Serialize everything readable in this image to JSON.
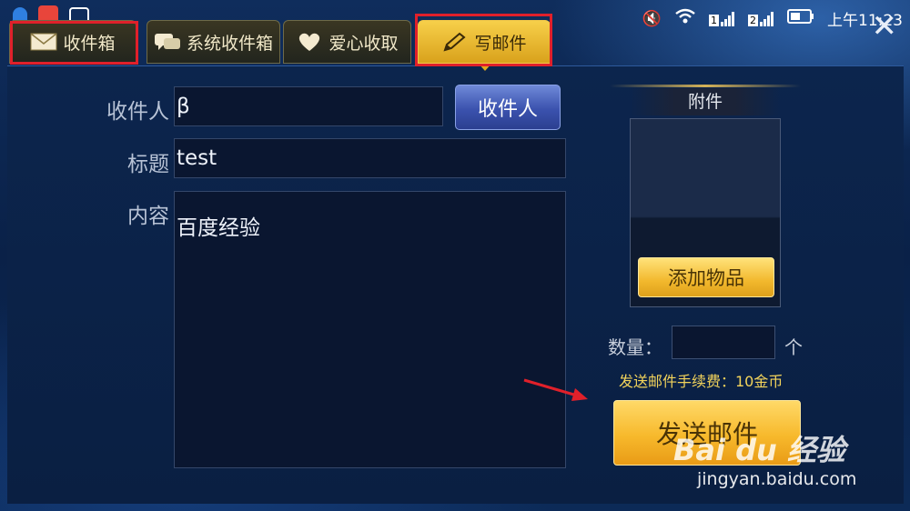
{
  "status_bar": {
    "time": "上午11:23",
    "sim1": "1",
    "sim2": "2"
  },
  "tabs": [
    {
      "label": "收件箱",
      "icon": "envelope-icon",
      "active": false
    },
    {
      "label": "系统收件箱",
      "icon": "chat-bubble-icon",
      "active": false
    },
    {
      "label": "爱心收取",
      "icon": "heart-icon",
      "active": false
    },
    {
      "label": "写邮件",
      "icon": "pencil-icon",
      "active": true
    }
  ],
  "form": {
    "recipient_label": "收件人",
    "recipient_value": "β",
    "recipient_button": "收件人",
    "subject_label": "标题",
    "subject_value": "test",
    "content_label": "内容",
    "content_value": "百度经验"
  },
  "attachment": {
    "title": "附件",
    "add_button": "添加物品",
    "quantity_label": "数量：",
    "quantity_unit": "个",
    "fee_text": "发送邮件手续费：10金币",
    "send_button": "发送邮件"
  },
  "watermark": {
    "brand": "Bai du 经验",
    "url": "jingyan.baidu.com"
  },
  "colors": {
    "active_tab": "#f2c23a",
    "send_button": "#f7b92c",
    "annotation": "#e0202a"
  }
}
